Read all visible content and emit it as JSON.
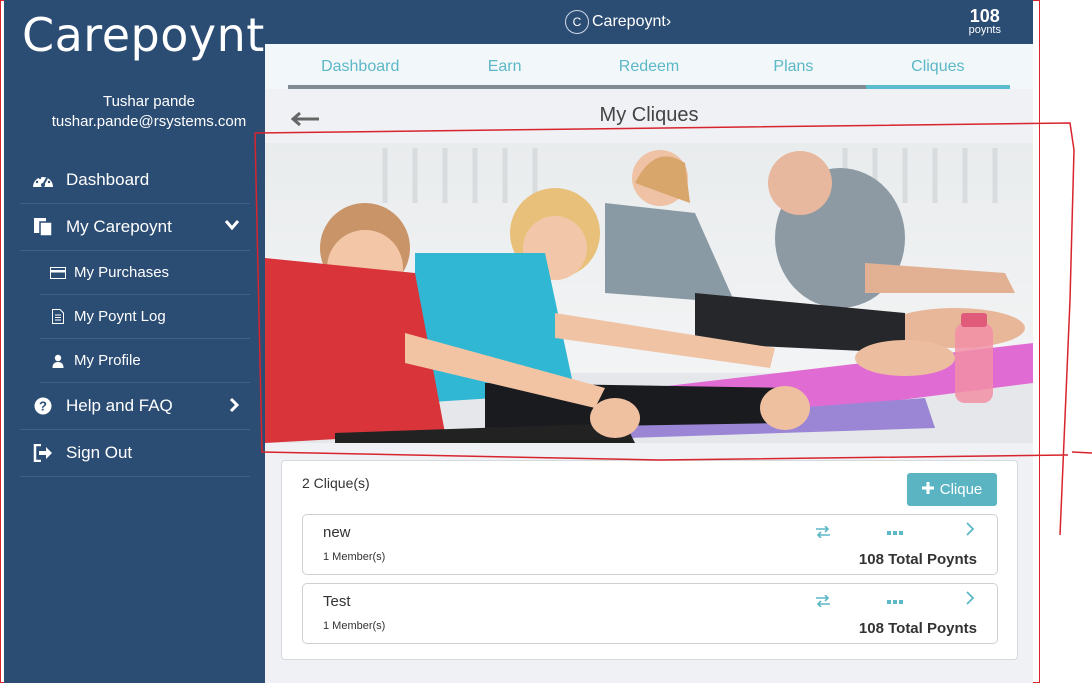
{
  "sidebar": {
    "brand": "Carepoynt›",
    "user_name": "Tushar pande",
    "user_email": "tushar.pande@rsystems.com",
    "items": [
      {
        "label": "Dashboard",
        "icon": "dashboard-icon"
      },
      {
        "label": "My Carepoynt",
        "icon": "documents-icon",
        "chevron": "chevron-down-icon"
      },
      {
        "label": "Help and FAQ",
        "icon": "question-circle-icon",
        "chevron": "chevron-right-icon"
      },
      {
        "label": "Sign Out",
        "icon": "sign-out-icon"
      }
    ],
    "sub_items": [
      {
        "label": "My Purchases",
        "icon": "credit-card-icon"
      },
      {
        "label": "My Poynt Log",
        "icon": "file-icon"
      },
      {
        "label": "My Profile",
        "icon": "user-icon"
      }
    ]
  },
  "header": {
    "logo_text": "Carepoynt›",
    "logo_mark": "C",
    "points_value": "108",
    "points_label": "poynts"
  },
  "tabs": [
    {
      "label": "Dashboard",
      "active": false
    },
    {
      "label": "Earn",
      "active": false
    },
    {
      "label": "Redeem",
      "active": false
    },
    {
      "label": "Plans",
      "active": false
    },
    {
      "label": "Cliques",
      "active": true
    }
  ],
  "main": {
    "title": "My Cliques",
    "back_icon": "arrow-left-icon",
    "clique_count": "2 Clique(s)",
    "add_button": "Clique",
    "cliques": [
      {
        "name": "new",
        "members": "1 Member(s)",
        "total": "108 Total Poynts"
      },
      {
        "name": "Test",
        "members": "1 Member(s)",
        "total": "108 Total Poynts"
      }
    ]
  },
  "colors": {
    "sidebar_bg": "#2b4c73",
    "accent": "#5bb4c2",
    "annotation": "#d8242d"
  }
}
